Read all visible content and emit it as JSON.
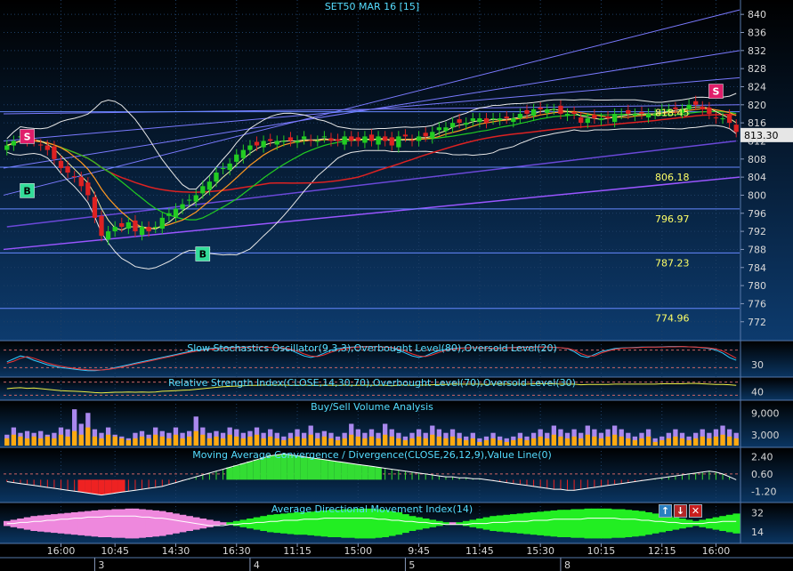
{
  "title": "SET50 MAR 16   [15]",
  "colors": {
    "bg_top": "#000000",
    "bg_bottom": "#0d3b6e",
    "panel_bg": "#041a33",
    "up": "#22cc22",
    "down": "#dd2222",
    "grid": "#1e3f66",
    "axis_text": "#d8d8d8"
  },
  "chart_data": [
    {
      "type": "candlestick",
      "name": "price",
      "title": "SET50 MAR 16   [15]",
      "ylim": [
        769,
        842
      ],
      "y_ticks": [
        772,
        776,
        780,
        784,
        788,
        792,
        796,
        800,
        804,
        808,
        812,
        816,
        820,
        824,
        828,
        832,
        836,
        840
      ],
      "last_price_label": "813.30",
      "horizontal_levels": [
        {
          "value": 818.45,
          "label": "818.45"
        },
        {
          "value": 806.18,
          "label": "806.18"
        },
        {
          "value": 796.97,
          "label": "796.97"
        },
        {
          "value": 787.23,
          "label": "787.23"
        },
        {
          "value": 774.96,
          "label": "774.96"
        }
      ],
      "signals": [
        {
          "type": "S",
          "bar": 3,
          "value": 813
        },
        {
          "type": "B",
          "bar": 3,
          "value": 801
        },
        {
          "type": "B",
          "bar": 29,
          "value": 787
        },
        {
          "type": "S",
          "bar": 105,
          "value": 823
        }
      ],
      "close": [
        811,
        812,
        813,
        812,
        812,
        811,
        810,
        808,
        806,
        805,
        804,
        802,
        800,
        795,
        791,
        792,
        793,
        793,
        794,
        792,
        793,
        792,
        793,
        795,
        796,
        797,
        798,
        799,
        800,
        802,
        803,
        805,
        806,
        807,
        809,
        810,
        811,
        811,
        812,
        812,
        812,
        812,
        812,
        812,
        813,
        812,
        812,
        813,
        812,
        812,
        813,
        812,
        812,
        813,
        812,
        813,
        812,
        811,
        813,
        813,
        812,
        813,
        813,
        814,
        815,
        815,
        816,
        816,
        816,
        817,
        817,
        816,
        817,
        817,
        817,
        817,
        818,
        818,
        819,
        819,
        819,
        819,
        818,
        818,
        818,
        816,
        817,
        817,
        817,
        817,
        818,
        818,
        818,
        818,
        818,
        818,
        818,
        819,
        819,
        819,
        819,
        820,
        820,
        819,
        818,
        817,
        817,
        816,
        814
      ]
    },
    {
      "type": "line",
      "name": "stochastic",
      "title": "Slow Stochastics Oscillator(9,3,3),Overbought Level(80),Oversold Level(20)",
      "ylim": [
        0,
        100
      ],
      "y_ticks": [
        30
      ],
      "levels": [
        80,
        20
      ],
      "series": [
        {
          "values": [
            40,
            50,
            60,
            55,
            45,
            38,
            30,
            25,
            20,
            18,
            15,
            12,
            10,
            10,
            12,
            15,
            20,
            25,
            30,
            35,
            40,
            45,
            50,
            55,
            60,
            65,
            70,
            75,
            80,
            82,
            85,
            87,
            88,
            89,
            90,
            90,
            91,
            90,
            90,
            89,
            88,
            85,
            80,
            70,
            60,
            55,
            60,
            70,
            80,
            85,
            88,
            90,
            91,
            92,
            92,
            91,
            90,
            88,
            80,
            70,
            60,
            55,
            60,
            70,
            78,
            82,
            85,
            87,
            88,
            88,
            87,
            86,
            86,
            87,
            88,
            89,
            90,
            90,
            91,
            91,
            90,
            89,
            88,
            85,
            75,
            60,
            55,
            65,
            75,
            80,
            85,
            87,
            88,
            89,
            90,
            90,
            90,
            91,
            92,
            92,
            92,
            91,
            90,
            88,
            85,
            80,
            70,
            55,
            45
          ]
        },
        {
          "values": [
            35,
            42,
            52,
            58,
            52,
            44,
            36,
            30,
            25,
            21,
            18,
            15,
            13,
            12,
            12,
            14,
            18,
            22,
            27,
            32,
            37,
            42,
            47,
            52,
            57,
            62,
            67,
            72,
            76,
            79,
            82,
            84,
            86,
            87,
            88,
            89,
            90,
            90,
            90,
            89,
            89,
            87,
            83,
            76,
            67,
            60,
            58,
            64,
            73,
            80,
            85,
            88,
            90,
            91,
            91,
            91,
            90,
            89,
            84,
            76,
            67,
            60,
            58,
            64,
            72,
            79,
            83,
            86,
            87,
            88,
            88,
            87,
            86,
            86,
            87,
            88,
            89,
            89,
            90,
            90,
            90,
            89,
            88,
            86,
            80,
            68,
            60,
            60,
            70,
            77,
            82,
            86,
            87,
            88,
            89,
            90,
            90,
            90,
            91,
            91,
            92,
            91,
            90,
            89,
            87,
            84,
            77,
            65,
            52
          ]
        }
      ]
    },
    {
      "type": "line",
      "name": "rsi",
      "title": "Relative Strength Index(CLOSE,14,30,70),Overbought Level(70),Oversold Level(30)",
      "ylim": [
        20,
        80
      ],
      "y_ticks": [
        40
      ],
      "levels": [
        70,
        30
      ],
      "series": [
        {
          "values": [
            50,
            52,
            53,
            51,
            52,
            50,
            48,
            46,
            44,
            43,
            42,
            41,
            40,
            38,
            37,
            38,
            39,
            39,
            40,
            39,
            40,
            39,
            40,
            42,
            43,
            44,
            45,
            46,
            48,
            50,
            52,
            54,
            56,
            57,
            58,
            59,
            60,
            60,
            61,
            61,
            61,
            61,
            60,
            60,
            61,
            60,
            60,
            61,
            60,
            60,
            61,
            60,
            60,
            61,
            60,
            61,
            60,
            59,
            61,
            61,
            60,
            61,
            61,
            62,
            63,
            63,
            64,
            64,
            64,
            64,
            64,
            63,
            64,
            64,
            64,
            64,
            64,
            64,
            65,
            65,
            65,
            65,
            64,
            64,
            64,
            62,
            63,
            63,
            63,
            63,
            64,
            64,
            64,
            64,
            64,
            64,
            64,
            65,
            65,
            65,
            65,
            66,
            66,
            65,
            64,
            63,
            63,
            62,
            60
          ]
        }
      ]
    },
    {
      "type": "bar",
      "name": "volume",
      "title": "Buy/Sell Volume Analysis",
      "ylim": [
        0,
        12000
      ],
      "y_ticks": [
        3000,
        9000
      ],
      "y_tick_labels": [
        "3,000",
        "9,000"
      ],
      "buy": [
        2000,
        3000,
        2500,
        2000,
        2500,
        2000,
        2500,
        2000,
        3000,
        2500,
        4000,
        3000,
        5000,
        2500,
        2000,
        3000,
        2500,
        2000,
        1500,
        2000,
        2500,
        2000,
        3000,
        2500,
        2000,
        3000,
        2000,
        2500,
        4000,
        3000,
        2000,
        2500,
        2000,
        3000,
        2500,
        2000,
        2500,
        3000,
        2000,
        2500,
        2000,
        1500,
        2000,
        2500,
        2000,
        3000,
        2000,
        2500,
        2000,
        1500,
        2000,
        3000,
        2500,
        2000,
        2500,
        2000,
        3000,
        2500,
        2000,
        1500,
        2000,
        2500,
        2000,
        3000,
        2500,
        2000,
        2500,
        2000,
        1500,
        2000,
        1000,
        1500,
        2000,
        1500,
        1000,
        1500,
        2000,
        1500,
        2000,
        2500,
        2000,
        3000,
        2500,
        2000,
        2500,
        2000,
        3000,
        2500,
        2000,
        2500,
        3000,
        2500,
        2000,
        1500,
        2000,
        2500,
        1000,
        1500,
        2000,
        2500,
        2000,
        1500,
        2000,
        2500,
        2000,
        2500,
        3000,
        2500,
        2000
      ],
      "sell": [
        3000,
        5000,
        3500,
        4000,
        3500,
        4000,
        3000,
        3500,
        5000,
        4500,
        10000,
        6000,
        9000,
        4500,
        3500,
        5000,
        3000,
        2500,
        2000,
        3500,
        4000,
        3000,
        5000,
        4000,
        3500,
        5000,
        3500,
        4000,
        8000,
        5000,
        3500,
        4000,
        3500,
        5000,
        4500,
        3500,
        4000,
        5000,
        3500,
        4500,
        3500,
        2500,
        3500,
        4500,
        3500,
        5500,
        3500,
        4000,
        3500,
        2500,
        3500,
        6000,
        4500,
        3500,
        4500,
        3500,
        6000,
        4500,
        3500,
        2500,
        3500,
        4500,
        3500,
        5500,
        4500,
        3500,
        4500,
        3500,
        2500,
        3500,
        2000,
        2500,
        3500,
        2500,
        2000,
        2500,
        3500,
        2500,
        3500,
        4500,
        3500,
        5500,
        4500,
        3500,
        4500,
        3500,
        5500,
        4500,
        3500,
        4500,
        5500,
        4500,
        3500,
        2500,
        3500,
        4500,
        2000,
        2500,
        3500,
        4500,
        3500,
        2500,
        3500,
        4500,
        3500,
        4500,
        5500,
        4500,
        3500
      ]
    },
    {
      "type": "bar",
      "name": "macd",
      "title": "Moving Average Convergence / Divergence(CLOSE,26,12,9),Value Line(0)",
      "ylim": [
        -2.2,
        3.2
      ],
      "y_ticks": [
        2.4,
        0.6,
        -1.2
      ],
      "y_tick_labels": [
        "2.40",
        "0.60",
        "-1.20"
      ],
      "values": [
        -0.2,
        -0.3,
        -0.4,
        -0.5,
        -0.6,
        -0.7,
        -0.8,
        -0.9,
        -1.0,
        -1.1,
        -1.2,
        -1.3,
        -1.4,
        -1.5,
        -1.6,
        -1.5,
        -1.4,
        -1.3,
        -1.2,
        -1.1,
        -1.0,
        -0.9,
        -0.8,
        -0.7,
        -0.5,
        -0.3,
        -0.1,
        0.1,
        0.3,
        0.5,
        0.7,
        0.9,
        1.1,
        1.3,
        1.5,
        1.7,
        1.9,
        2.1,
        2.3,
        2.5,
        2.6,
        2.7,
        2.6,
        2.5,
        2.4,
        2.3,
        2.2,
        2.1,
        2.0,
        1.9,
        1.8,
        1.7,
        1.6,
        1.5,
        1.4,
        1.3,
        1.2,
        1.1,
        1.0,
        0.9,
        0.8,
        0.7,
        0.6,
        0.5,
        0.4,
        0.3,
        0.3,
        0.2,
        0.2,
        0.1,
        0.1,
        0.0,
        -0.1,
        -0.2,
        -0.3,
        -0.4,
        -0.5,
        -0.6,
        -0.7,
        -0.8,
        -0.9,
        -1.0,
        -1.0,
        -1.1,
        -1.1,
        -1.0,
        -0.9,
        -0.8,
        -0.7,
        -0.6,
        -0.5,
        -0.4,
        -0.3,
        -0.2,
        -0.1,
        0.0,
        0.1,
        0.2,
        0.3,
        0.4,
        0.5,
        0.6,
        0.7,
        0.8,
        0.9,
        0.8,
        0.6,
        0.3,
        0.0
      ]
    },
    {
      "type": "area",
      "name": "adx",
      "title": "Average Directional Movement Index(14)",
      "ylim": [
        5,
        40
      ],
      "y_ticks": [
        14,
        32
      ],
      "values": [
        -4,
        -6,
        -8,
        -10,
        -12,
        -13,
        -14,
        -15,
        -16,
        -17,
        -18,
        -19,
        -20,
        -21,
        -22,
        -22,
        -23,
        -23,
        -24,
        -24,
        -23,
        -22,
        -21,
        -20,
        -18,
        -16,
        -14,
        -12,
        -10,
        -8,
        -6,
        -4,
        -2,
        2,
        4,
        6,
        8,
        10,
        12,
        14,
        15,
        16,
        17,
        18,
        18,
        19,
        20,
        21,
        22,
        22,
        23,
        23,
        24,
        24,
        24,
        23,
        22,
        20,
        18,
        15,
        12,
        10,
        8,
        6,
        4,
        2,
        -2,
        2,
        4,
        6,
        8,
        10,
        12,
        13,
        14,
        15,
        16,
        17,
        18,
        19,
        20,
        21,
        22,
        22,
        23,
        23,
        24,
        24,
        24,
        24,
        23,
        23,
        22,
        21,
        20,
        18,
        16,
        14,
        12,
        10,
        8,
        6,
        4,
        6,
        8,
        10,
        12,
        14,
        16
      ],
      "adx": [
        22,
        22,
        23,
        23,
        24,
        24,
        25,
        25,
        26,
        26,
        27,
        27,
        28,
        28,
        28,
        29,
        29,
        29,
        29,
        29,
        28,
        28,
        27,
        27,
        26,
        25,
        24,
        23,
        22,
        21,
        20,
        20,
        20,
        21,
        21,
        22,
        22,
        23,
        23,
        24,
        24,
        25,
        25,
        25,
        26,
        26,
        26,
        27,
        27,
        27,
        27,
        27,
        27,
        27,
        27,
        26,
        26,
        25,
        25,
        24,
        24,
        23,
        23,
        22,
        22,
        21,
        21,
        21,
        21,
        22,
        22,
        22,
        23,
        23,
        23,
        24,
        24,
        24,
        25,
        25,
        25,
        26,
        26,
        26,
        26,
        26,
        27,
        27,
        27,
        27,
        27,
        26,
        26,
        26,
        25,
        25,
        24,
        24,
        23,
        23,
        22,
        22,
        22,
        22,
        23,
        23,
        24,
        24,
        24
      ]
    }
  ],
  "x_axis": {
    "time_labels": [
      "16:00",
      "10:45",
      "14:30",
      "16:30",
      "11:15",
      "15:00",
      "9:45",
      "11:45",
      "15:30",
      "10:15",
      "12:15",
      "16:00"
    ],
    "time_label_bars": [
      8,
      16,
      25,
      34,
      43,
      52,
      61,
      70,
      79,
      88,
      97,
      105
    ],
    "day_labels": [
      "3",
      "4",
      "5",
      "8"
    ],
    "day_label_bars": [
      13,
      36,
      59,
      82
    ]
  },
  "toolbar": {
    "up_label": "↑",
    "down_label": "↓",
    "close_label": "✕"
  },
  "icons": {
    "up": "up-arrow-icon",
    "down": "down-arrow-icon",
    "close": "close-icon"
  }
}
